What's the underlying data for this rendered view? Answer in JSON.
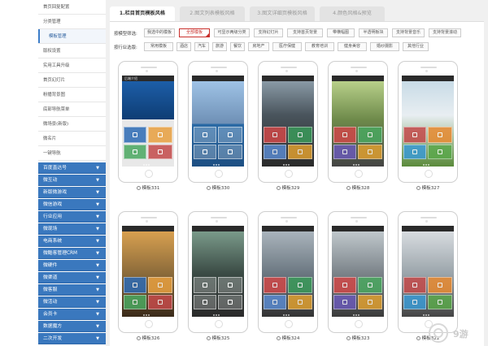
{
  "sidebar": {
    "sub_items": [
      {
        "label": "首页回复配置",
        "active": false,
        "indent": false
      },
      {
        "label": "分类管理",
        "active": false,
        "indent": false
      },
      {
        "label": "模板管理",
        "active": true,
        "indent": true
      },
      {
        "label": "版权设置",
        "active": false,
        "indent": false
      },
      {
        "label": "实用工具升级",
        "active": false,
        "indent": false
      },
      {
        "label": "首页幻灯片",
        "active": false,
        "indent": false
      },
      {
        "label": "粉播背景图",
        "active": false,
        "indent": false
      },
      {
        "label": "底部导航菜单",
        "active": false,
        "indent": false
      },
      {
        "label": "微场景(新版)",
        "active": false,
        "indent": false
      },
      {
        "label": "微名片",
        "active": false,
        "indent": false
      },
      {
        "label": "一键导航",
        "active": false,
        "indent": false
      },
      {
        "label": "在线预览",
        "active": false,
        "indent": false
      }
    ],
    "sections": [
      "百度直达号",
      "微互动",
      "新版微游戏",
      "微信游戏",
      "行业应用",
      "微现场",
      "电商系统",
      "微酷客管理CRM",
      "微硬件",
      "微渠道",
      "微客服",
      "微活动",
      "会员卡",
      "数据魔方",
      "二次开发"
    ],
    "section_chevron": "▼"
  },
  "tabs": [
    {
      "label": "1.栏目首页模板风格",
      "active": true
    },
    {
      "label": "2.图文列表模板风格",
      "active": false
    },
    {
      "label": "3.图文详细页模板风格",
      "active": false
    },
    {
      "label": "4.颜色风格&预览",
      "active": false
    }
  ],
  "filters": {
    "feature_label": "按模型筛选:",
    "feature_options": [
      {
        "label": "我选中的模板",
        "selected": false
      },
      {
        "label": "全部模板",
        "selected": true
      },
      {
        "label": "可显示两级分类",
        "selected": false
      },
      {
        "label": "支持幻灯片",
        "selected": false
      },
      {
        "label": "支持首页背景",
        "selected": false
      },
      {
        "label": "带横幅图",
        "selected": false
      },
      {
        "label": "半透明板块",
        "selected": false
      },
      {
        "label": "支持背景音乐",
        "selected": false
      },
      {
        "label": "支持背景滚动",
        "selected": false
      }
    ],
    "industry_label": "按行业选版:",
    "industry_options": [
      {
        "label": "常用模板"
      },
      {
        "label": "酒店"
      },
      {
        "label": "汽车"
      },
      {
        "label": "旅游"
      },
      {
        "label": "餐饮"
      },
      {
        "label": "房地产"
      },
      {
        "label": "医疗保健"
      },
      {
        "label": "教育培训"
      },
      {
        "label": "健身美容"
      },
      {
        "label": "婚纱摄影"
      },
      {
        "label": "其他行业"
      }
    ]
  },
  "templates": [
    {
      "name": "模板331",
      "screen_title": "后端介绍"
    },
    {
      "name": "模板330",
      "screen_title": ""
    },
    {
      "name": "模板329",
      "screen_title": ""
    },
    {
      "name": "模板328",
      "screen_title": ""
    },
    {
      "name": "模板327",
      "screen_title": ""
    },
    {
      "name": "模板326",
      "screen_title": ""
    },
    {
      "name": "模板325",
      "screen_title": ""
    },
    {
      "name": "模板324",
      "screen_title": ""
    },
    {
      "name": "模板323",
      "screen_title": ""
    },
    {
      "name": "模板322",
      "screen_title": ""
    }
  ],
  "watermark": {
    "text": "9游"
  }
}
